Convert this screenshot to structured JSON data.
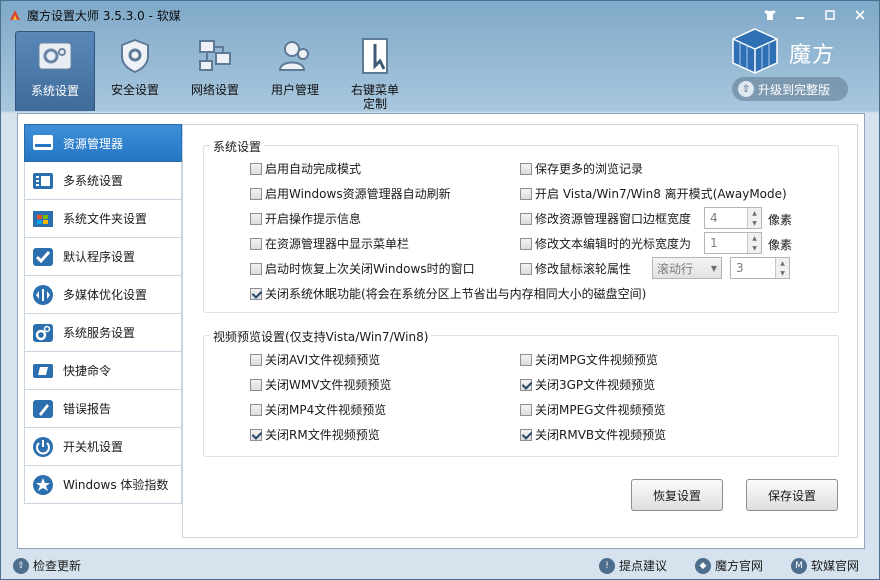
{
  "window": {
    "title": "魔方设置大师 3.5.3.0 - 软媒",
    "controls": [
      "shirt-icon",
      "minimize-icon",
      "maximize-icon",
      "close-icon"
    ]
  },
  "toolbar": {
    "tabs": [
      {
        "label": "系统设置",
        "icon": "gear-screen-icon",
        "active": true
      },
      {
        "label": "安全设置",
        "icon": "shield-gear-icon",
        "active": false
      },
      {
        "label": "网络设置",
        "icon": "network-icon",
        "active": false
      },
      {
        "label": "用户管理",
        "icon": "users-icon",
        "active": false
      },
      {
        "label": "右键菜单\n定制",
        "icon": "context-menu-icon",
        "active": false
      }
    ]
  },
  "brand": {
    "name": "魔方",
    "upgrade_label": "升级到完整版"
  },
  "sidebar": {
    "items": [
      {
        "label": "资源管理器",
        "icon": "explorer-icon",
        "active": true
      },
      {
        "label": "多系统设置",
        "icon": "multi-system-icon",
        "active": false
      },
      {
        "label": "系统文件夹设置",
        "icon": "windows-folder-icon",
        "active": false
      },
      {
        "label": "默认程序设置",
        "icon": "checkmark-icon",
        "active": false
      },
      {
        "label": "多媒体优化设置",
        "icon": "media-icon",
        "active": false
      },
      {
        "label": "系统服务设置",
        "icon": "service-gear-icon",
        "active": false
      },
      {
        "label": "快捷命令",
        "icon": "shortcut-icon",
        "active": false
      },
      {
        "label": "错误报告",
        "icon": "report-icon",
        "active": false
      },
      {
        "label": "开关机设置",
        "icon": "power-icon",
        "active": false
      },
      {
        "label": "Windows 体验指数",
        "icon": "star-icon",
        "active": false
      }
    ]
  },
  "system_group": {
    "title": "系统设置",
    "left": [
      {
        "label": "启用自动完成模式",
        "checked": false
      },
      {
        "label": "启用Windows资源管理器自动刷新",
        "checked": false
      },
      {
        "label": "开启操作提示信息",
        "checked": false
      },
      {
        "label": "在资源管理器中显示菜单栏",
        "checked": false
      },
      {
        "label": "启动时恢复上次关闭Windows时的窗口",
        "checked": false
      },
      {
        "label": "关闭系统休眠功能(将会在系统分区上节省出与内存相同大小的磁盘空间)",
        "checked": true
      }
    ],
    "right": [
      {
        "label": "保存更多的浏览记录",
        "checked": false
      },
      {
        "label": "开启 Vista/Win7/Win8 离开模式(AwayMode)",
        "checked": false
      },
      {
        "label": "修改资源管理器窗口边框宽度",
        "checked": false
      },
      {
        "label": "修改文本编辑时的光标宽度为",
        "checked": false
      },
      {
        "label": "修改鼠标滚轮属性",
        "checked": false
      }
    ],
    "border_width_value": "4",
    "cursor_width_value": "1",
    "unit_label": "像素",
    "wheel_mode": "滚动行",
    "wheel_value": "3"
  },
  "video_group": {
    "title": "视频预览设置(仅支持Vista/Win7/Win8)",
    "left": [
      {
        "label": "关闭AVI文件视频预览",
        "checked": false
      },
      {
        "label": "关闭WMV文件视频预览",
        "checked": false
      },
      {
        "label": "关闭MP4文件视频预览",
        "checked": false
      },
      {
        "label": "关闭RM文件视频预览",
        "checked": true
      }
    ],
    "right": [
      {
        "label": "关闭MPG文件视频预览",
        "checked": false
      },
      {
        "label": "关闭3GP文件视频预览",
        "checked": true
      },
      {
        "label": "关闭MPEG文件视频预览",
        "checked": false
      },
      {
        "label": "关闭RMVB文件视频预览",
        "checked": true
      }
    ]
  },
  "actions": {
    "restore_label": "恢复设置",
    "save_label": "保存设置"
  },
  "statusbar": {
    "check_update": "检查更新",
    "feedback": "提点建议",
    "official_site": "魔方官网",
    "ruanmei_site": "软媒官网"
  }
}
